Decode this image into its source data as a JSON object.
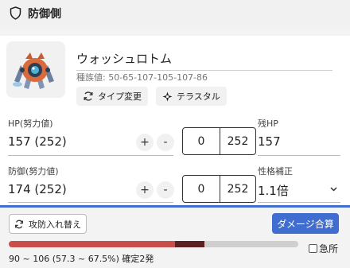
{
  "header": {
    "title": "防御側",
    "icon": "shield-icon"
  },
  "pokemon": {
    "name": "ウォッシュロトム",
    "base_stats": "種族値: 50-65-107-105-107-86"
  },
  "buttons": {
    "type_change": "タイプ変更",
    "tera": "テラスタル",
    "swap": "攻防入れ替え",
    "calc": "ダメージ合算"
  },
  "hp": {
    "label": "HP(努力値)",
    "value": "157 (252)",
    "plus": "+",
    "minus": "-",
    "rank": "0",
    "ev": "252"
  },
  "remaining_hp": {
    "label": "残HP",
    "value": "157"
  },
  "defense": {
    "label": "防御(努力値)",
    "value": "174 (252)",
    "plus": "+",
    "minus": "-",
    "rank": "0",
    "ev": "252"
  },
  "nature": {
    "label": "性格補正",
    "value": "1.1倍"
  },
  "result": {
    "text": "90 ~ 106 (57.3 ~ 67.5%) 確定2発",
    "min_percent": 57.3,
    "max_percent": 67.5
  },
  "crit": {
    "label": "急所",
    "checked": false
  },
  "colors": {
    "accent": "#3f6ed0",
    "damage_min": "#c9504a",
    "damage_range": "#5a2222"
  }
}
